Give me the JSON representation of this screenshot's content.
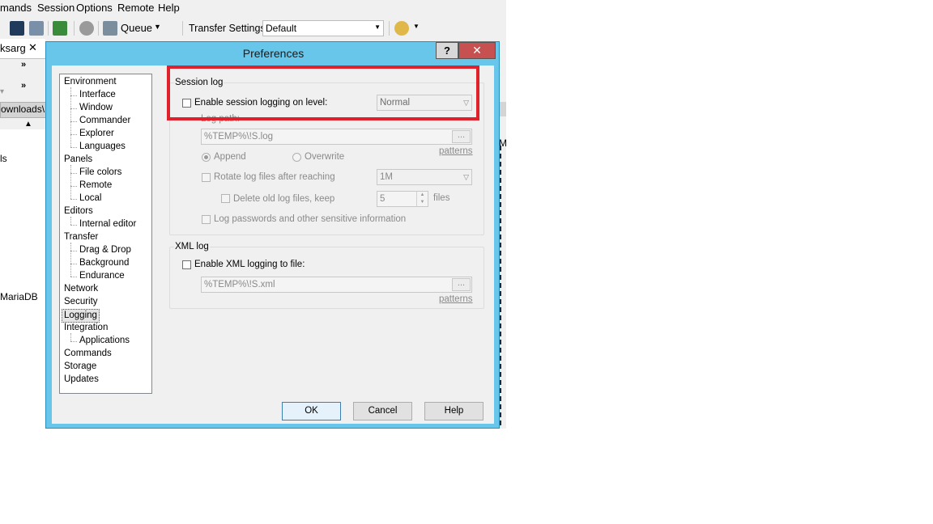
{
  "menubar": {
    "items": [
      "mands",
      "Session",
      "Options",
      "Remote",
      "Help"
    ]
  },
  "toolbar": {
    "queue_label": "Queue",
    "transfer_settings_label": "Transfer Settings",
    "transfer_settings_value": "Default"
  },
  "background": {
    "tab_label": "ksarg",
    "path_fragment": "ownloads\\",
    "list_fragment_1": "ls",
    "list_fragment_2": "MariaDB",
    "right_fragment": "M"
  },
  "dialog": {
    "title": "Preferences",
    "help_glyph": "?",
    "close_glyph": "✕",
    "tree": [
      {
        "label": "Environment",
        "level": 0
      },
      {
        "label": "Interface",
        "level": 1
      },
      {
        "label": "Window",
        "level": 1
      },
      {
        "label": "Commander",
        "level": 1
      },
      {
        "label": "Explorer",
        "level": 1
      },
      {
        "label": "Languages",
        "level": 1
      },
      {
        "label": "Panels",
        "level": 0
      },
      {
        "label": "File colors",
        "level": 1
      },
      {
        "label": "Remote",
        "level": 1
      },
      {
        "label": "Local",
        "level": 1
      },
      {
        "label": "Editors",
        "level": 0
      },
      {
        "label": "Internal editor",
        "level": 1
      },
      {
        "label": "Transfer",
        "level": 0
      },
      {
        "label": "Drag & Drop",
        "level": 1
      },
      {
        "label": "Background",
        "level": 1
      },
      {
        "label": "Endurance",
        "level": 1
      },
      {
        "label": "Network",
        "level": 0
      },
      {
        "label": "Security",
        "level": 0
      },
      {
        "label": "Logging",
        "level": 0,
        "selected": true
      },
      {
        "label": "Integration",
        "level": 0
      },
      {
        "label": "Applications",
        "level": 1
      },
      {
        "label": "Commands",
        "level": 0
      },
      {
        "label": "Storage",
        "level": 0
      },
      {
        "label": "Updates",
        "level": 0
      }
    ],
    "session_log": {
      "group_title": "Session log",
      "enable_label": "Enable session logging on level:",
      "level_value": "Normal",
      "log_path_label": "Log path:",
      "log_path_value": "%TEMP%\\!S.log",
      "browse_label": "...",
      "patterns_label": "patterns",
      "append_label": "Append",
      "overwrite_label": "Overwrite",
      "rotate_label": "Rotate log files after reaching",
      "rotate_value": "1M",
      "delete_label": "Delete old log files, keep",
      "delete_value": "5",
      "files_label": "files",
      "passwords_label": "Log passwords and other sensitive information"
    },
    "xml_log": {
      "group_title": "XML log",
      "enable_label": "Enable XML logging to file:",
      "path_value": "%TEMP%\\!S.xml",
      "browse_label": "...",
      "patterns_label": "patterns"
    },
    "buttons": {
      "ok": "OK",
      "cancel": "Cancel",
      "help": "Help"
    }
  },
  "colors": {
    "dialog_frame": "#68c6ea",
    "close_button": "#c75050",
    "highlight": "#e0202a"
  }
}
